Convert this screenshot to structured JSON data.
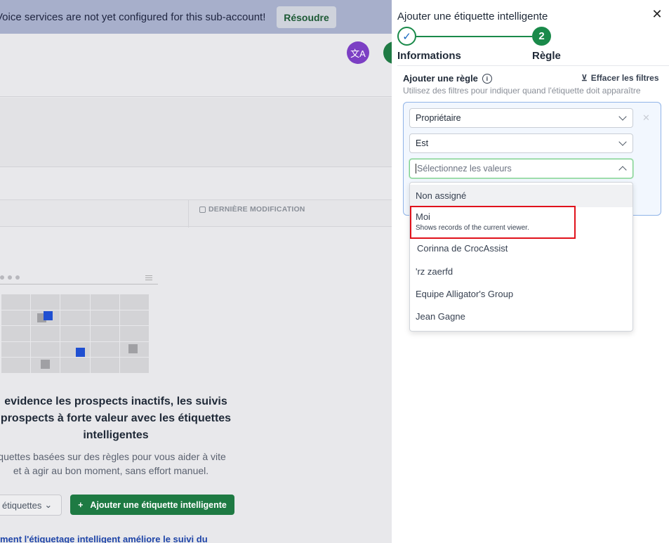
{
  "background": {
    "banner_text": "Voice services are not yet configured for this sub-account!",
    "resolve_label": "Résoudre",
    "translate_icon": "translate-icon",
    "column_header": "DERNIÈRE MODIFICATION",
    "heading": "evidence les prospects inactifs, les suivis prospects à forte valeur avec les étiquettes intelligentes",
    "description": "iquettes basées sur des règles pour vous aider à vite et à agir au bon moment, sans effort manuel.",
    "filter_label": "étiquettes",
    "add_button_label": "Ajouter une étiquette intelligente",
    "help_link": "ment l'étiquetage intelligent améliore le suivi du",
    "colors": {
      "brand_green": "#1e7a43",
      "banner": "#a7afcb",
      "accent_blue": "#1f4fd1"
    }
  },
  "drawer": {
    "title": "Ajouter une étiquette intelligente",
    "close_icon": "close-icon",
    "steps": [
      {
        "number": "1",
        "label": "Informations",
        "status": "completed"
      },
      {
        "number": "2",
        "label": "Règle",
        "status": "active"
      }
    ],
    "rule": {
      "title": "Ajouter une règle",
      "subtitle": "Utilisez des filtres pour indiquer quand l'étiquette doit apparaître",
      "clear_filters": "Effacer les filtres",
      "field_select": "Propriétaire",
      "operator_select": "Est",
      "value_placeholder": "Sélectionnez les valeurs"
    },
    "dropdown": {
      "options": [
        {
          "label": "Non assigné"
        },
        {
          "label": "Moi",
          "description": "Shows records of the current viewer."
        },
        {
          "label": "Corinna de CrocAssist"
        },
        {
          "label": "'rz zaerfd"
        },
        {
          "label": "Equipe Alligator's Group"
        },
        {
          "label": "Jean Gagne"
        }
      ]
    }
  }
}
